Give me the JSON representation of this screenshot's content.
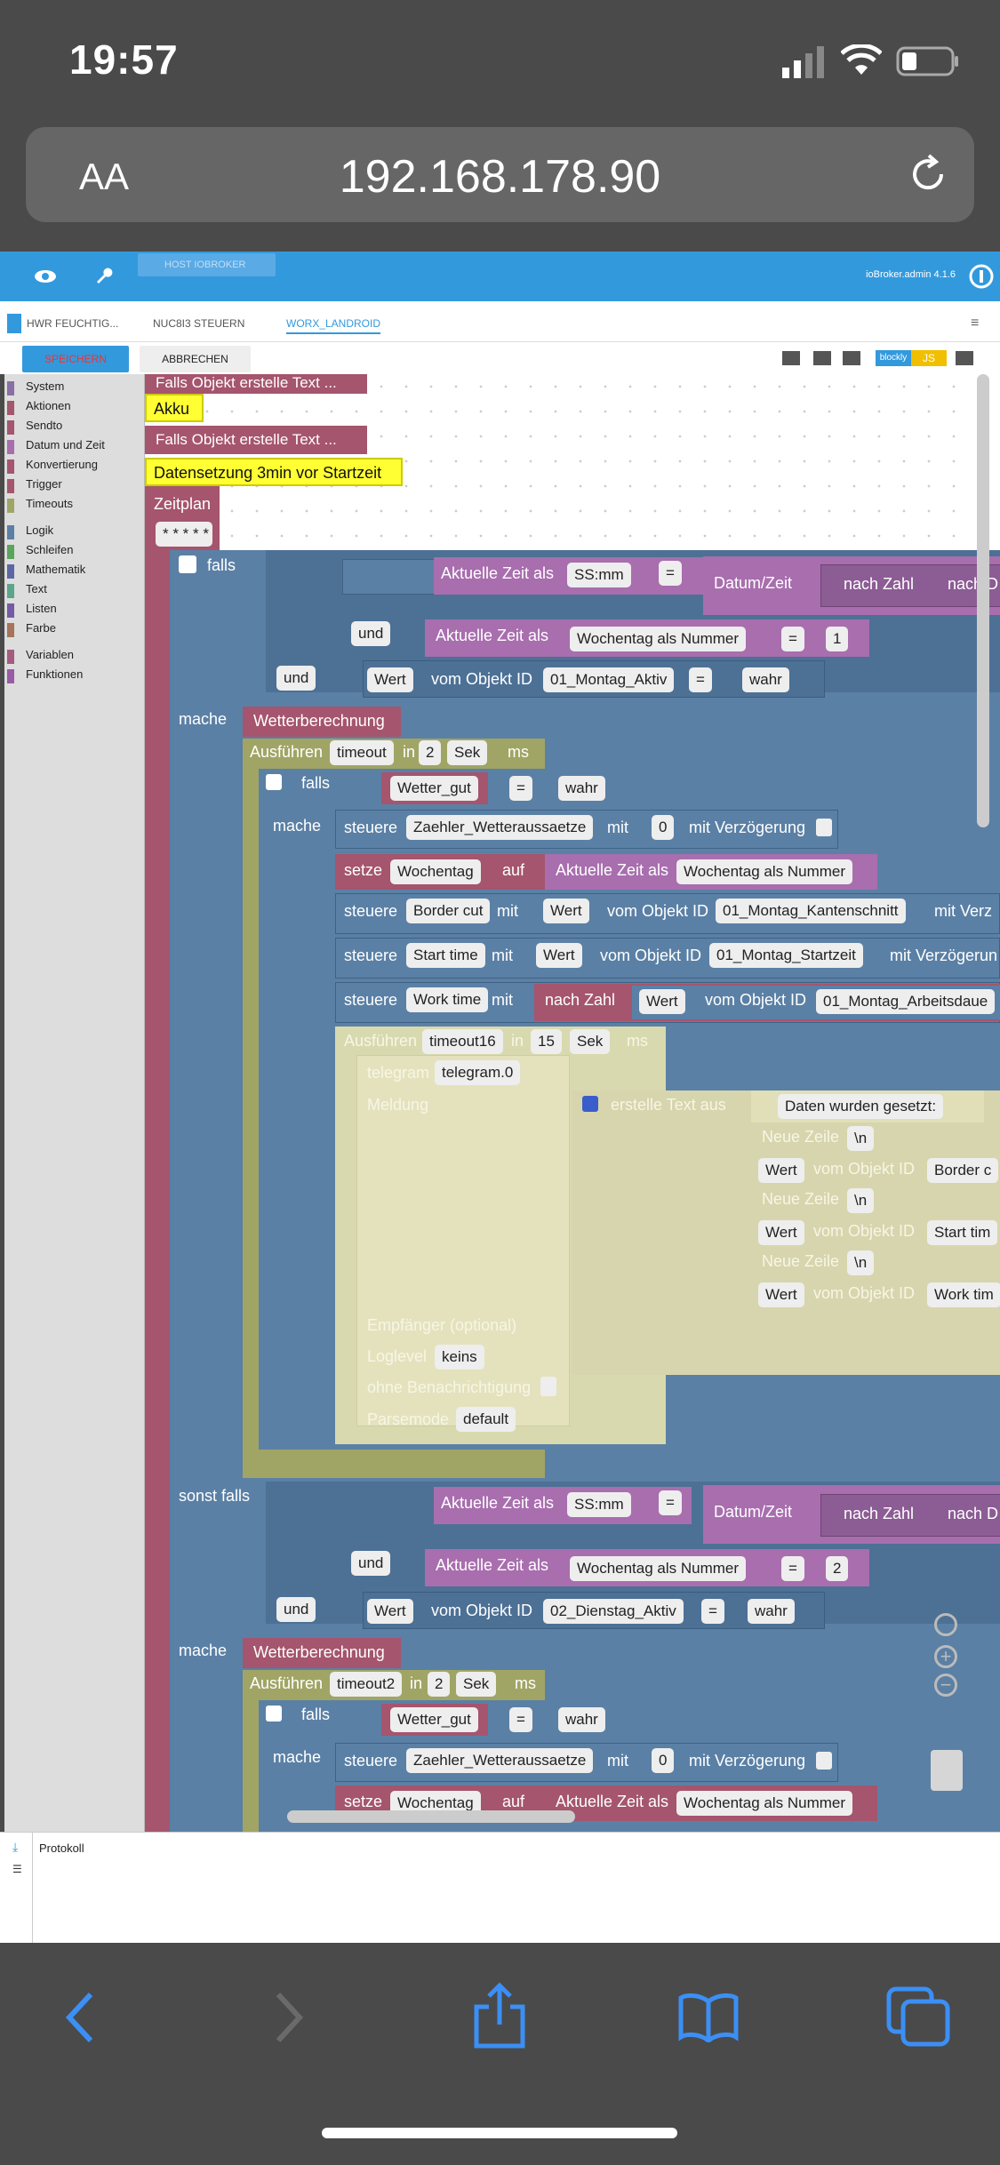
{
  "status": {
    "time": "19:57"
  },
  "browser": {
    "text_size": "AA",
    "url": "192.168.178.90"
  },
  "header": {
    "host": "HOST IOBROKER",
    "version": "ioBroker.admin 4.1.6"
  },
  "tabs": [
    "HWR FEUCHTIG...",
    "NUC8I3 STEUERN",
    "WORX_LANDROID"
  ],
  "toolbar": {
    "save": "SPEICHERN",
    "cancel": "ABBRECHEN",
    "blockly": "blockly",
    "js": "JS"
  },
  "categories": [
    {
      "label": "System",
      "color": "#8a6fa6"
    },
    {
      "label": "Aktionen",
      "color": "#a5556e"
    },
    {
      "label": "Sendto",
      "color": "#a5556e"
    },
    {
      "label": "Datum und Zeit",
      "color": "#a86eae"
    },
    {
      "label": "Konvertierung",
      "color": "#a5556e"
    },
    {
      "label": "Trigger",
      "color": "#a5556e"
    },
    {
      "label": "Timeouts",
      "color": "#a0a565"
    },
    {
      "label": "Logik",
      "color": "#5b80a5"
    },
    {
      "label": "Schleifen",
      "color": "#5ba55b"
    },
    {
      "label": "Mathematik",
      "color": "#5b67a5"
    },
    {
      "label": "Text",
      "color": "#5ba58c"
    },
    {
      "label": "Listen",
      "color": "#745ba5"
    },
    {
      "label": "Farbe",
      "color": "#a5745b"
    },
    {
      "label": "Variablen",
      "color": "#a55b80"
    },
    {
      "label": "Funktionen",
      "color": "#995ba5"
    }
  ],
  "blocks": {
    "falls_objekt_1": "Falls Objekt erstelle Text ...",
    "akku": "Akku",
    "falls_objekt_2": "Falls Objekt erstelle Text ...",
    "datensetzung": "Datensetzung 3min vor Startzeit",
    "zeitplan": "Zeitplan",
    "zeitplan_val": "* * * * *",
    "falls": "falls",
    "aktuelle_zeit_als": "Aktuelle Zeit als",
    "ssmm": "SS:mm",
    "eq": "=",
    "datum_zeit": "Datum/Zeit",
    "nach_zahl": "nach Zahl",
    "nach_d": "nach D",
    "und": "und",
    "wochentag_als_nummer": "Wochentag als Nummer",
    "one": "1",
    "wert": "Wert",
    "vom_objekt_id": "vom Objekt ID",
    "montag_aktiv": "01_Montag_Aktiv",
    "wahr": "wahr",
    "mache": "mache",
    "wetterberechnung": "Wetterberechnung",
    "ausfuehren": "Ausführen",
    "timeout": "timeout",
    "in": "in",
    "two": "2",
    "sek": "Sek",
    "ms": "ms",
    "wetter_gut": "Wetter_gut",
    "steuere": "steuere",
    "zaehler": "Zaehler_Wetteraussaetze",
    "mit": "mit",
    "zero": "0",
    "mit_verzoegerung": "mit Verzögerung",
    "setze": "setze",
    "wochentag": "Wochentag",
    "auf": "auf",
    "border_cut": "Border cut",
    "montag_kantenschnitt": "01_Montag_Kantenschnitt",
    "mit_verz": "mit Verz",
    "start_time": "Start time",
    "montag_startzeit": "01_Montag_Startzeit",
    "mit_verzoegerun": "mit Verzögerun",
    "work_time": "Work time",
    "montag_arbeitsdauer": "01_Montag_Arbeitsdaue",
    "timeout16": "timeout16",
    "fifteen": "15",
    "telegram": "telegram",
    "telegram0": "telegram.0",
    "meldung": "Meldung",
    "erstelle_text_aus": "erstelle Text aus",
    "daten_gesetzt": "Daten wurden gesetzt:",
    "neue_zeile": "Neue Zeile",
    "nl": "\\n",
    "border_c": "Border c",
    "start_tim": "Start tim",
    "work_tim": "Work tim",
    "empfaenger": "Empfänger (optional)",
    "loglevel": "Loglevel",
    "keins": "keins",
    "ohne_benachrichtigung": "ohne Benachrichtigung",
    "parsemode": "Parsemode",
    "default": "default",
    "sonst_falls": "sonst falls",
    "two_b": "2",
    "dienstag_aktiv": "02_Dienstag_Aktiv",
    "timeout2": "timeout2"
  },
  "log": {
    "label": "Protokoll"
  }
}
